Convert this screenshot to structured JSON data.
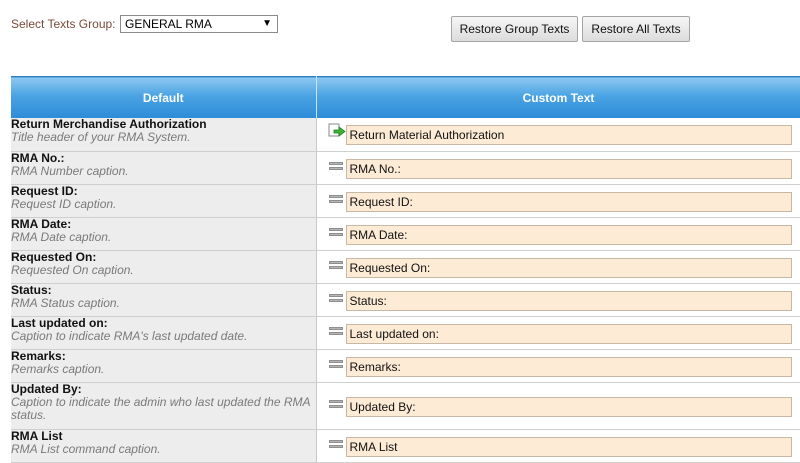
{
  "toolbar": {
    "group_label": "Select Texts Group:",
    "group_value": "GENERAL RMA",
    "restore_group_label": "Restore Group Texts",
    "restore_all_label": "Restore All Texts"
  },
  "table": {
    "headers": {
      "default": "Default",
      "custom": "Custom Text"
    },
    "rows": [
      {
        "title": "Return Merchandise Authorization",
        "desc": "Title header of your RMA System.",
        "value": "Return Material Authorization",
        "state": "edited"
      },
      {
        "title": "RMA No.:",
        "desc": "RMA Number caption.",
        "value": "RMA No.:",
        "state": "default"
      },
      {
        "title": "Request ID:",
        "desc": "Request ID caption.",
        "value": "Request ID:",
        "state": "default"
      },
      {
        "title": "RMA Date:",
        "desc": "RMA Date caption.",
        "value": "RMA Date:",
        "state": "default"
      },
      {
        "title": "Requested On:",
        "desc": "Requested On caption.",
        "value": "Requested On:",
        "state": "default"
      },
      {
        "title": "Status:",
        "desc": "RMA Status caption.",
        "value": "Status:",
        "state": "default"
      },
      {
        "title": "Last updated on:",
        "desc": "Caption to indicate RMA's last updated date.",
        "value": "Last updated on:",
        "state": "default"
      },
      {
        "title": "Remarks:",
        "desc": "Remarks caption.",
        "value": "Remarks:",
        "state": "default"
      },
      {
        "title": "Updated By:",
        "desc": "Caption to indicate the admin who last updated the RMA status.",
        "value": "Updated By:",
        "state": "default"
      },
      {
        "title": "RMA List",
        "desc": "RMA List command caption.",
        "value": "RMA List",
        "state": "default"
      }
    ]
  },
  "icons": {
    "edited": "green-arrow-icon",
    "default": "equals-icon"
  },
  "colors": {
    "header_blue": "#3a95dc",
    "input_bg": "#fdebd6",
    "label_brown": "#7a4a3a"
  }
}
